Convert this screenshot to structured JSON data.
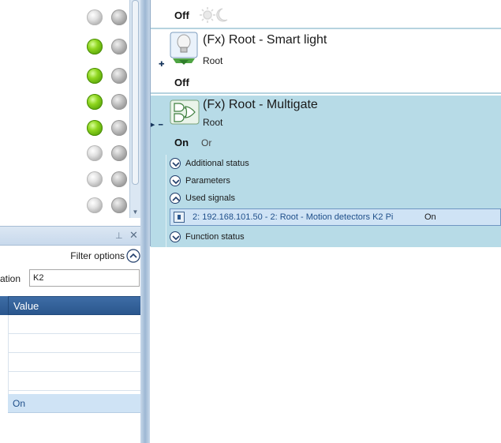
{
  "left_panel": {
    "leds": [
      {
        "a": "gray",
        "b": "dark"
      },
      {
        "a": "green",
        "b": "dark"
      },
      {
        "a": "green",
        "b": "dark"
      },
      {
        "a": "green",
        "b": "dark"
      },
      {
        "a": "green",
        "b": "dark"
      },
      {
        "a": "gray",
        "b": "dark"
      },
      {
        "a": "gray",
        "b": "dark"
      },
      {
        "a": "gray",
        "b": "dark"
      }
    ],
    "filter_label": "Filter options",
    "location_label": "ation",
    "location_value": "K2",
    "value_header": "Value",
    "selected_value": "On"
  },
  "devices": {
    "top_state": "Off",
    "smart_light": {
      "title": "(Fx) Root - Smart light",
      "subtitle": "Root",
      "state": "Off"
    },
    "multigate": {
      "title": "(Fx) Root - Multigate",
      "subtitle": "Root",
      "state": "On",
      "logic": "Or"
    }
  },
  "sections": {
    "additional_status": "Additional status",
    "parameters": "Parameters",
    "used_signals": "Used signals",
    "function_status": "Function status"
  },
  "used_signal": {
    "name": "2: 192.168.101.50 - 2: Root - Motion detectors K2 Pi",
    "value": "On"
  }
}
